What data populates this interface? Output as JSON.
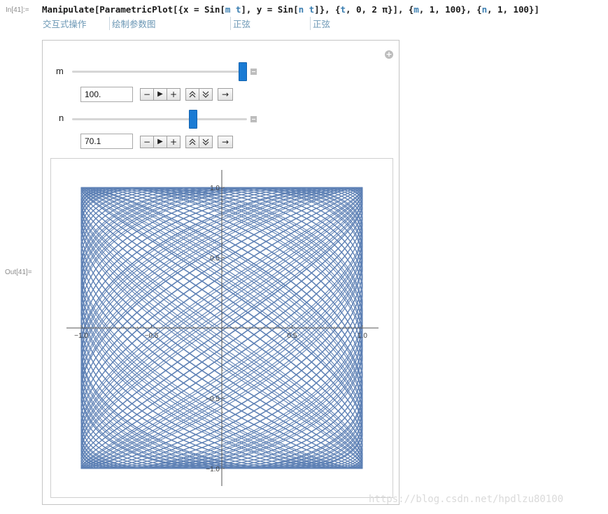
{
  "input_cell": {
    "label": "In[41]:=",
    "code_parts": [
      "Manipulate[ParametricPlot[{x = Sin[",
      "m",
      " ",
      "t",
      "], y = Sin[",
      "n",
      " ",
      "t",
      "]}, {",
      "t",
      ", 0, 2 π}], {",
      "m",
      ", 1, 100}, {",
      "n",
      ", 1, 100}]"
    ],
    "hints": [
      "交互式操作",
      "绘制参数图",
      "正弦",
      "正弦"
    ]
  },
  "output_cell": {
    "label": "Out[41]=",
    "controls": [
      {
        "name": "m",
        "value": "100.",
        "fraction": 1.0
      },
      {
        "name": "n",
        "value": "70.1",
        "fraction": 0.7
      }
    ],
    "button_icons": [
      "minus-icon",
      "play-icon",
      "plus-icon",
      "faster-icon",
      "slower-icon",
      "direction-icon"
    ],
    "button_glyphs": [
      "−",
      "▶",
      "+",
      "˄",
      "˅",
      "→"
    ],
    "colors": {
      "curve": "#5e81b5",
      "thumb": "#1a7bd4"
    }
  },
  "chart_data": {
    "type": "line",
    "parametric": true,
    "x_expr": "Sin[m t]",
    "y_expr": "Sin[n t]",
    "t_range": [
      0,
      6.283185307179586
    ],
    "m": 100,
    "n": 70.1,
    "xlim": [
      -1,
      1
    ],
    "ylim": [
      -1,
      1
    ],
    "x_ticks": [
      "-1.0",
      "-0.5",
      "0.5",
      "1.0"
    ],
    "y_ticks": [
      "1.0",
      "0.5",
      "-0.5",
      "-1.0"
    ],
    "color": "#5e81b5",
    "grid": false,
    "title": "",
    "xlabel": "",
    "ylabel": ""
  },
  "watermark": "https://blog.csdn.net/hpdlzu80100"
}
